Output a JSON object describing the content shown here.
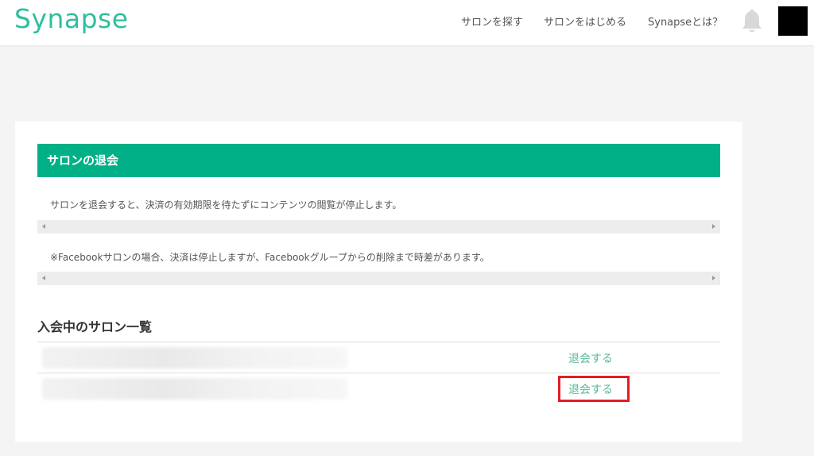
{
  "header": {
    "logo": "Synapse",
    "nav": [
      "サロンを探す",
      "サロンをはじめる",
      "Synapseとは？"
    ],
    "bell_icon": "bell-icon",
    "accent_color": "#2fbf9d"
  },
  "main": {
    "section_title": "サロンの退会",
    "section_color": "#02b087",
    "notes": [
      "サロンを退会すると、決済の有効期限を待たずにコンテンツの閲覧が停止します。",
      "※Facebookサロンの場合、決済は停止しますが、Facebookグループからの削除まで時差があります。"
    ],
    "list_title": "入会中のサロン一覧",
    "salons": [
      {
        "action_label": "退会する"
      },
      {
        "action_label": "退会する"
      }
    ],
    "highlight_color": "#e41c24"
  }
}
